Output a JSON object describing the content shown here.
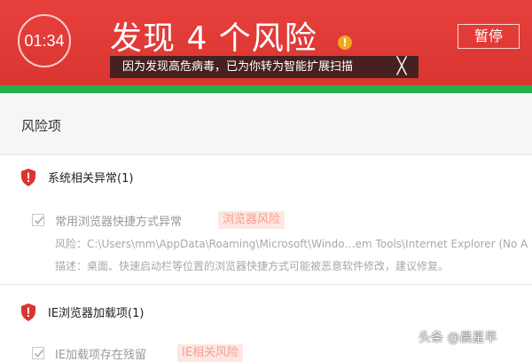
{
  "header": {
    "timer": "01:34",
    "title": "发现 4 个风险",
    "warn_symbol": "!",
    "pause_label": "暂停",
    "toast_text": "因为发现高危病毒，已为你转为智能扩展扫描",
    "toast_close": "╳",
    "colors": {
      "header_bg": "#e03a37",
      "accent_bar": "#22b04b"
    }
  },
  "section": {
    "title": "风险项"
  },
  "groups": [
    {
      "title": "系统相关异常(1)",
      "items": [
        {
          "name": "常用浏览器快捷方式异常",
          "tag": "浏览器风险",
          "risk_line": "风险：C:\\Users\\mm\\AppData\\Roaming\\Microsoft\\Windo…em Tools\\Internet Explorer (No A",
          "desc_line": "描述：桌面、快速启动栏等位置的浏览器快捷方式可能被恶意软件修改，建议修复。"
        }
      ]
    },
    {
      "title": "IE浏览器加载项(1)",
      "items": [
        {
          "name": "IE加载项存在残留",
          "tag": "IE相关风险"
        }
      ]
    }
  ],
  "watermark": "头条 @晨星早"
}
